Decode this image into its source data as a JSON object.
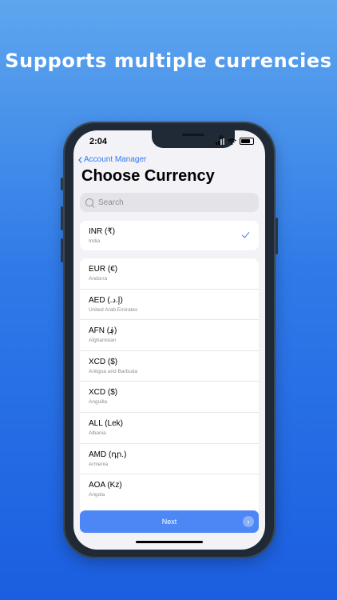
{
  "headline": "Supports multiple currencies",
  "status_bar": {
    "time": "2:04"
  },
  "nav": {
    "back_label": "Account Manager",
    "title": "Choose Currency"
  },
  "search": {
    "placeholder": "Search"
  },
  "selected": {
    "code": "INR (₹)",
    "country": "India"
  },
  "currencies": [
    {
      "code": "EUR (€)",
      "country": "Andorra"
    },
    {
      "code": "AED (.إ.د)",
      "country": "United Arab Emirates"
    },
    {
      "code": "AFN (؋)",
      "country": "Afghanistan"
    },
    {
      "code": "XCD ($)",
      "country": "Antigua and Barbuda"
    },
    {
      "code": "XCD ($)",
      "country": "Anguilla"
    },
    {
      "code": "ALL (Lek)",
      "country": "Albania"
    },
    {
      "code": "AMD (դր.)",
      "country": "Armenia"
    },
    {
      "code": "AOA (Kz)",
      "country": "Angola"
    }
  ],
  "next_button": {
    "label": "Next",
    "arrow": "›"
  },
  "colors": {
    "accent": "#3478f6",
    "button": "#4d86f5",
    "background_top": "#5ea6ee",
    "background_bottom": "#1b5ee0"
  },
  "icons": [
    "chevron-left-icon",
    "search-icon",
    "checkmark-icon",
    "chevron-right-icon",
    "signal-icon",
    "wifi-icon",
    "battery-icon"
  ]
}
